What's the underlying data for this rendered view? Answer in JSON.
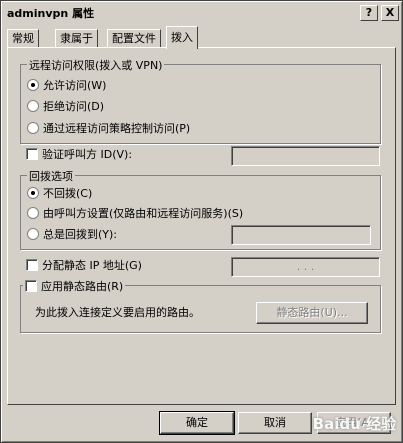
{
  "window": {
    "title": "adminvpn 属性",
    "help_glyph": "?",
    "close_glyph": "X"
  },
  "tabs": [
    "常规",
    "隶属于",
    "配置文件",
    "拨入"
  ],
  "remote_access": {
    "legend": "远程访问权限(拨入或 VPN)",
    "options": [
      "允许访问(W)",
      "拒绝访问(D)",
      "通过远程访问策略控制访问(P)"
    ],
    "selected_index": 0
  },
  "verify_caller": {
    "label": "验证呼叫方 ID(V):",
    "value": ""
  },
  "callback": {
    "legend": "回拨选项",
    "options": [
      "不回拨(C)",
      "由呼叫方设置(仅路由和远程访问服务)(S)",
      "总是回拨到(Y):"
    ],
    "selected_index": 0,
    "always_value": ""
  },
  "static_ip": {
    "label": "分配静态 IP 地址(G)",
    "dots": ".    .    ."
  },
  "static_routes": {
    "label": "应用静态路由(R)",
    "description": "为此拨入连接定义要启用的路由。",
    "button": "静态路由(U)..."
  },
  "footer": {
    "ok": "确定",
    "cancel": "取消",
    "apply": "应用(A)"
  },
  "watermark": "Baidu 经验"
}
